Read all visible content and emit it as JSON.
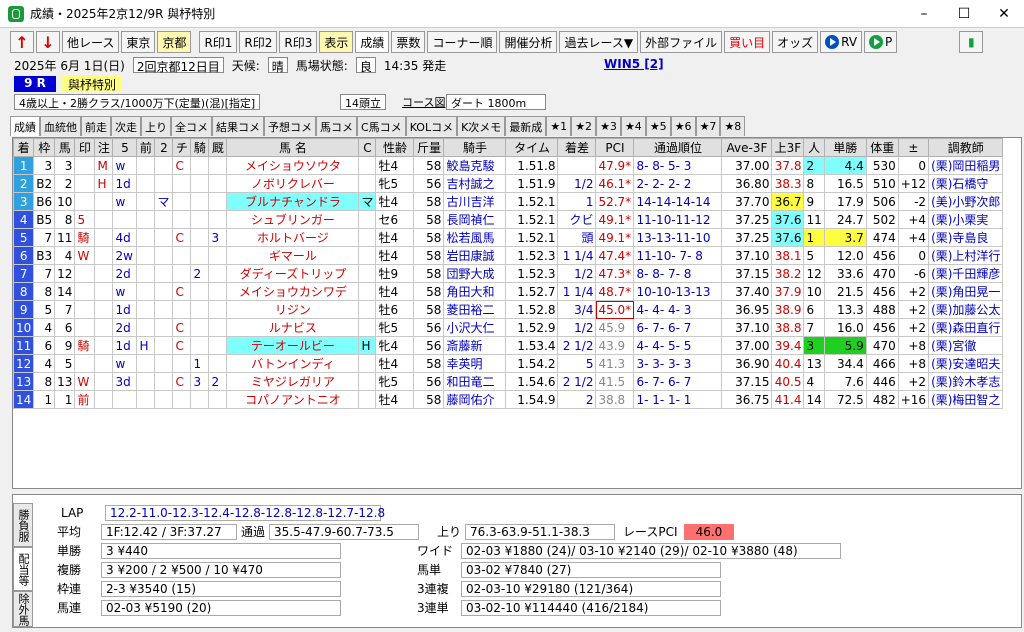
{
  "window": {
    "title": "成績・2025年2京12/9R 與杼特別"
  },
  "toolbar": {
    "up": "↑",
    "down": "↓",
    "other_race": "他レース",
    "tokyo": "東京",
    "kyoto": "京都",
    "r1": "R印1",
    "r2": "R印2",
    "r3": "R印3",
    "display": "表示",
    "results": "成績",
    "votes": "票数",
    "corner": "コーナー順",
    "analysis": "開催分析",
    "past": "過去レース▼",
    "external": "外部ファイル",
    "buy": "買い目",
    "odds": "オッズ",
    "rv": "RV",
    "p": "P"
  },
  "race": {
    "date": "2025年 6月 1日(日)",
    "meet": "2回京都12日目",
    "weather_label": "天候:",
    "weather": "晴",
    "track_label": "馬場状態:",
    "track_cond": "良",
    "start": "14:35 発走",
    "win5": "WIN5 [2]",
    "number": "9 R",
    "name": "與杼特別",
    "conditions": "4歳以上・2勝クラス/1000万下(定量)(混)[指定]",
    "heads": "14頭立",
    "course": "コース図",
    "surface": "ダート 1800m"
  },
  "tabs": [
    "成績",
    "血統他",
    "前走",
    "次走",
    "上り",
    "全コメ",
    "結果コメ",
    "予想コメ",
    "馬コメ",
    "C馬コメ",
    "KOLコメ",
    "K次メモ",
    "最新成",
    "★1",
    "★2",
    "★3",
    "★4",
    "★5",
    "★6",
    "★7",
    "★8"
  ],
  "columns": [
    "着",
    "枠",
    "馬",
    "印",
    "注",
    "5",
    "前",
    "2",
    "チ",
    "騎",
    "厩",
    "馬 名",
    "C",
    "性齢",
    "斤量",
    "騎手",
    "タイム",
    "着差",
    "PCI",
    "通過順位",
    "Ave-3F",
    "上3F",
    "人",
    "単勝",
    "体重",
    "±",
    "調教師"
  ],
  "rows": [
    {
      "rank": "1",
      "waku": "3",
      "uma": "3",
      "mark": "",
      "chu": "M",
      "c5": "w",
      "mae": "",
      "c2": "",
      "chi": "C",
      "ki": "",
      "kyu": "",
      "name": "メイショウソウタ",
      "cm": "",
      "sex": "牡4",
      "kin": "58",
      "jockey": "鮫島克駿",
      "time": "1.51.8",
      "diff": "",
      "pci": "47.9*",
      "pass": "8- 8- 5- 3",
      "ave": "37.00",
      "up3": "37.8",
      "pop": "2",
      "odds": "4.4",
      "weight": "530",
      "pm": "0",
      "trainer": "(栗)岡田稲男"
    },
    {
      "rank": "2",
      "waku": "B2",
      "uma": "2",
      "mark": "",
      "chu": "H",
      "c5": "1d",
      "mae": "",
      "c2": "",
      "chi": "",
      "ki": "",
      "kyu": "",
      "name": "ノボリクレバー",
      "cm": "",
      "sex": "牝5",
      "kin": "56",
      "jockey": "吉村誠之",
      "time": "1.51.9",
      "diff": "1/2",
      "pci": "46.1*",
      "pass": "2- 2- 2- 2",
      "ave": "36.80",
      "up3": "38.3",
      "pop": "8",
      "odds": "16.5",
      "weight": "510",
      "pm": "+12",
      "trainer": "(栗)石橋守"
    },
    {
      "rank": "3",
      "waku": "B6",
      "uma": "10",
      "mark": "",
      "chu": "",
      "c5": "w",
      "mae": "",
      "c2": "マ",
      "chi": "",
      "ki": "",
      "kyu": "",
      "name": "ブルナチャンドラ",
      "cm": "マ",
      "sex": "牡4",
      "kin": "58",
      "jockey": "古川吉洋",
      "time": "1.52.1",
      "diff": "1",
      "pci": "52.7*",
      "pass": "14-14-14-14",
      "ave": "37.70",
      "up3": "36.7",
      "pop": "9",
      "odds": "17.9",
      "weight": "506",
      "pm": "-2",
      "trainer": "(美)小野次郎"
    },
    {
      "rank": "4",
      "waku": "B5",
      "uma": "8",
      "mark": "5",
      "chu": "",
      "c5": "",
      "mae": "",
      "c2": "",
      "chi": "",
      "ki": "",
      "kyu": "",
      "name": "シュブリンガー",
      "cm": "",
      "sex": "セ6",
      "kin": "58",
      "jockey": "長岡禎仁",
      "time": "1.52.1",
      "diff": "クビ",
      "pci": "49.1*",
      "pass": "11-10-11-12",
      "ave": "37.25",
      "up3": "37.6",
      "pop": "11",
      "odds": "24.7",
      "weight": "502",
      "pm": "+4",
      "trainer": "(栗)小栗実"
    },
    {
      "rank": "5",
      "waku": "7",
      "uma": "11",
      "mark": "騎",
      "chu": "",
      "c5": "4d",
      "mae": "",
      "c2": "",
      "chi": "C",
      "ki": "",
      "kyu": "3",
      "name": "ホルトバージ",
      "cm": "",
      "sex": "牡4",
      "kin": "58",
      "jockey": "松若風馬",
      "time": "1.52.1",
      "diff": "頭",
      "pci": "49.1*",
      "pass": "13-13-11-10",
      "ave": "37.25",
      "up3": "37.6",
      "pop": "1",
      "odds": "3.7",
      "weight": "474",
      "pm": "+4",
      "trainer": "(栗)寺島良"
    },
    {
      "rank": "6",
      "waku": "B3",
      "uma": "4",
      "mark": "W",
      "chu": "",
      "c5": "2w",
      "mae": "",
      "c2": "",
      "chi": "",
      "ki": "",
      "kyu": "",
      "name": "ギマール",
      "cm": "",
      "sex": "牡4",
      "kin": "58",
      "jockey": "岩田康誠",
      "time": "1.52.3",
      "diff": "1 1/4",
      "pci": "47.4*",
      "pass": "11-10- 7- 8",
      "ave": "37.10",
      "up3": "38.1",
      "pop": "5",
      "odds": "12.0",
      "weight": "456",
      "pm": "0",
      "trainer": "(栗)上村洋行"
    },
    {
      "rank": "7",
      "waku": "7",
      "uma": "12",
      "mark": "",
      "chu": "",
      "c5": "2d",
      "mae": "",
      "c2": "",
      "chi": "",
      "ki": "2",
      "kyu": "",
      "name": "ダディーズトリップ",
      "cm": "",
      "sex": "牡9",
      "kin": "58",
      "jockey": "団野大成",
      "time": "1.52.3",
      "diff": "1/2",
      "pci": "47.3*",
      "pass": "8- 8- 7- 8",
      "ave": "37.15",
      "up3": "38.2",
      "pop": "12",
      "odds": "33.6",
      "weight": "470",
      "pm": "-6",
      "trainer": "(栗)千田輝彦"
    },
    {
      "rank": "8",
      "waku": "8",
      "uma": "14",
      "mark": "",
      "chu": "",
      "c5": "w",
      "mae": "",
      "c2": "",
      "chi": "C",
      "ki": "",
      "kyu": "",
      "name": "メイショウカシワデ",
      "cm": "",
      "sex": "牡4",
      "kin": "58",
      "jockey": "角田大和",
      "time": "1.52.7",
      "diff": "1 1/4",
      "pci": "48.7*",
      "pass": "10-10-13-13",
      "ave": "37.40",
      "up3": "37.9",
      "pop": "10",
      "odds": "21.5",
      "weight": "456",
      "pm": "+2",
      "trainer": "(栗)角田晃一"
    },
    {
      "rank": "9",
      "waku": "5",
      "uma": "7",
      "mark": "",
      "chu": "",
      "c5": "1d",
      "mae": "",
      "c2": "",
      "chi": "",
      "ki": "",
      "kyu": "",
      "name": "リジン",
      "cm": "",
      "sex": "牡6",
      "kin": "58",
      "jockey": "菱田裕二",
      "time": "1.52.8",
      "diff": "3/4",
      "pci": "45.0*",
      "pass": "4- 4- 4- 3",
      "ave": "36.95",
      "up3": "38.9",
      "pop": "6",
      "odds": "13.3",
      "weight": "488",
      "pm": "+2",
      "trainer": "(栗)加藤公太"
    },
    {
      "rank": "10",
      "waku": "4",
      "uma": "6",
      "mark": "",
      "chu": "",
      "c5": "2d",
      "mae": "",
      "c2": "",
      "chi": "C",
      "ki": "",
      "kyu": "",
      "name": "ルナビス",
      "cm": "",
      "sex": "牝5",
      "kin": "56",
      "jockey": "小沢大仁",
      "time": "1.52.9",
      "diff": "1/2",
      "pci": "45.9",
      "pass": "6- 7- 6- 7",
      "ave": "37.10",
      "up3": "38.8",
      "pop": "7",
      "odds": "16.0",
      "weight": "456",
      "pm": "+2",
      "trainer": "(栗)森田直行"
    },
    {
      "rank": "11",
      "waku": "6",
      "uma": "9",
      "mark": "騎",
      "chu": "",
      "c5": "1d",
      "mae": "H",
      "c2": "",
      "chi": "C",
      "ki": "",
      "kyu": "",
      "name": "テーオールビー",
      "cm": "H",
      "sex": "牝4",
      "kin": "56",
      "jockey": "斎藤新",
      "time": "1.53.4",
      "diff": "2 1/2",
      "pci": "43.9",
      "pass": "4- 4- 5- 5",
      "ave": "37.00",
      "up3": "39.4",
      "pop": "3",
      "odds": "5.9",
      "weight": "470",
      "pm": "+8",
      "trainer": "(栗)宮徹"
    },
    {
      "rank": "12",
      "waku": "4",
      "uma": "5",
      "mark": "",
      "chu": "",
      "c5": "w",
      "mae": "",
      "c2": "",
      "chi": "",
      "ki": "1",
      "kyu": "",
      "name": "バトンインディ",
      "cm": "",
      "sex": "牡4",
      "kin": "58",
      "jockey": "幸英明",
      "time": "1.54.2",
      "diff": "5",
      "pci": "41.3",
      "pass": "3- 3- 3- 3",
      "ave": "36.90",
      "up3": "40.4",
      "pop": "13",
      "odds": "34.4",
      "weight": "466",
      "pm": "+8",
      "trainer": "(栗)安達昭夫"
    },
    {
      "rank": "13",
      "waku": "8",
      "uma": "13",
      "mark": "W",
      "chu": "",
      "c5": "3d",
      "mae": "",
      "c2": "",
      "chi": "C",
      "ki": "3",
      "kyu": "2",
      "name": "ミヤジレガリア",
      "cm": "",
      "sex": "牝5",
      "kin": "56",
      "jockey": "和田竜二",
      "time": "1.54.6",
      "diff": "2 1/2",
      "pci": "41.5",
      "pass": "6- 7- 6- 7",
      "ave": "37.15",
      "up3": "40.5",
      "pop": "4",
      "odds": "7.6",
      "weight": "446",
      "pm": "+2",
      "trainer": "(栗)鈴木孝志"
    },
    {
      "rank": "14",
      "waku": "1",
      "uma": "1",
      "mark": "前",
      "chu": "",
      "c5": "",
      "mae": "",
      "c2": "",
      "chi": "",
      "ki": "",
      "kyu": "",
      "name": "コパノアントニオ",
      "cm": "",
      "sex": "牡4",
      "kin": "58",
      "jockey": "藤岡佑介",
      "time": "1.54.9",
      "diff": "2",
      "pci": "38.8",
      "pass": "1- 1- 1- 1",
      "ave": "36.75",
      "up3": "41.4",
      "pop": "14",
      "odds": "72.5",
      "weight": "482",
      "pm": "+16",
      "trainer": "(栗)梅田智之"
    }
  ],
  "bottom": {
    "tabs": [
      "勝負服",
      "配当等",
      "除外馬"
    ],
    "lap_label": "LAP",
    "lap": "12.2-11.0-12.3-12.4-12.8-12.8-12.8-12.7-12.8",
    "avg_label": "平均",
    "avg": "1F:12.42 / 3F:37.27",
    "pass_label": "通過",
    "pass": "35.5-47.9-60.7-73.5",
    "up_label": "上り",
    "up": "76.3-63.9-51.1-38.3",
    "racepci_label": "レースPCI",
    "racepci": "46.0",
    "tan_label": "単勝",
    "tan": "3 ¥440",
    "fuku_label": "複勝",
    "fuku": "3 ¥200 / 2 ¥500 / 10 ¥470",
    "waku_label": "枠連",
    "waku": "2-3 ¥3540 (15)",
    "umaren_label": "馬連",
    "umaren": "02-03 ¥5190 (20)",
    "wide_label": "ワイド",
    "wide": "02-03 ¥1880 (24)/ 03-10 ¥2140 (29)/ 02-10 ¥3880 (48)",
    "umatan_label": "馬単",
    "umatan": "03-02 ¥7840 (27)",
    "sanfuku_label": "3連複",
    "sanfuku": "02-03-10 ¥29180 (121/364)",
    "santan_label": "3連単",
    "santan": "03-02-10 ¥114440 (416/2184)"
  },
  "colors": {
    "waku": [
      "#ffffff",
      "#000000",
      "#ff0000",
      "#0000ff",
      "#ffff00",
      "#00a000",
      "#ff8000",
      "#ff80c0"
    ]
  }
}
